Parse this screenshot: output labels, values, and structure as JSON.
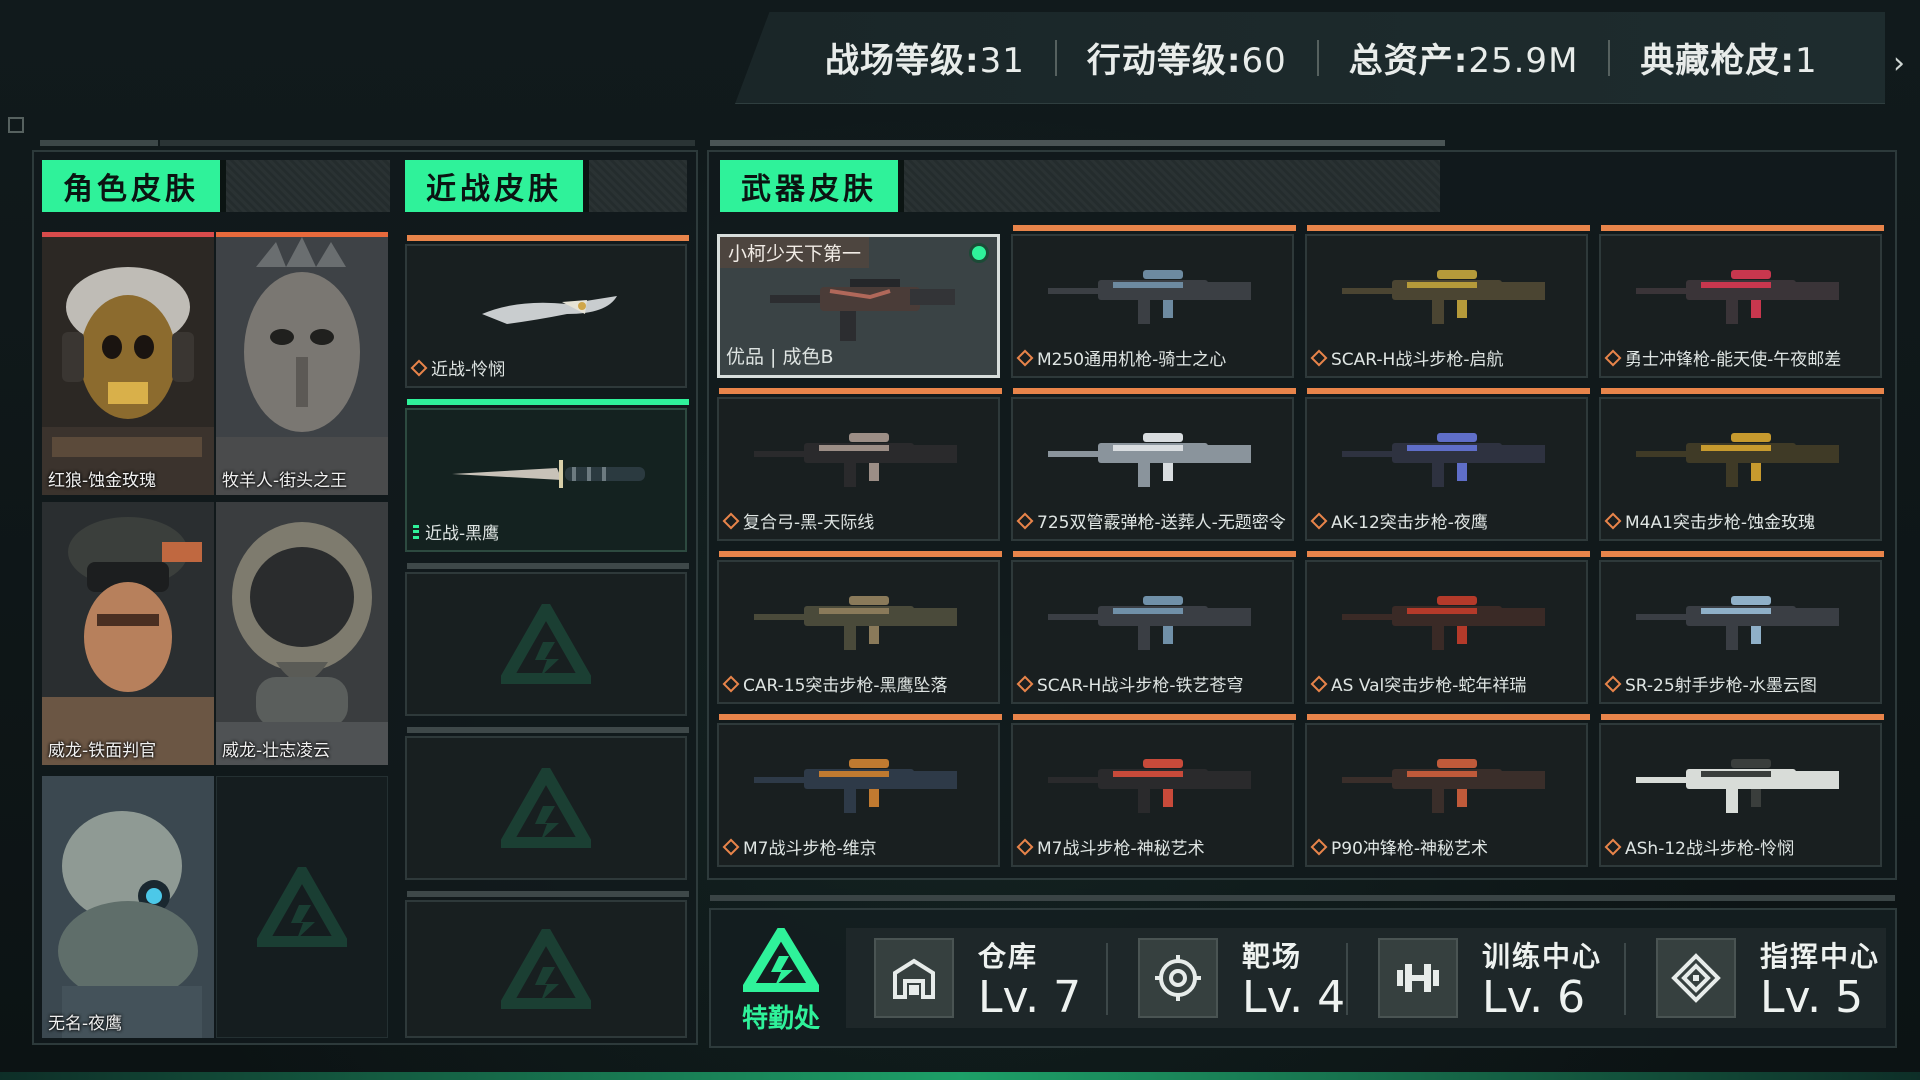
{
  "stats": [
    {
      "label": "战场等级:",
      "value": "31"
    },
    {
      "label": "行动等级:",
      "value": "60"
    },
    {
      "label": "总资产:",
      "value": "25.9M"
    },
    {
      "label": "典藏枪皮:",
      "value": "1"
    }
  ],
  "tabs": {
    "character": "角色皮肤",
    "melee": "近战皮肤",
    "weapon": "武器皮肤"
  },
  "characters": [
    {
      "name": "红狼-蚀金玫瑰"
    },
    {
      "name": "牧羊人-街头之王"
    },
    {
      "name": "威龙-铁面判官"
    },
    {
      "name": "威龙-壮志凌云"
    },
    {
      "name": "无名-夜鹰"
    }
  ],
  "melee": [
    {
      "name": "近战-怜悯"
    },
    {
      "name": "近战-黑鹰"
    }
  ],
  "featured_weapon": {
    "title": "小柯少天下第一",
    "quality": "优品 | 成色B"
  },
  "weapons": [
    "M250通用机枪-骑士之心",
    "SCAR-H战斗步枪-启航",
    "勇士冲锋枪-能天使-午夜邮差",
    "复合弓-黑-天际线",
    "725双管霰弹枪-送葬人-无题密令",
    "AK-12突击步枪-夜鹰",
    "M4A1突击步枪-蚀金玫瑰",
    "CAR-15突击步枪-黑鹰坠落",
    "SCAR-H战斗步枪-铁艺苍穹",
    "AS Val突击步枪-蛇年祥瑞",
    "SR-25射手步枪-水墨云图",
    "M7战斗步枪-维京",
    "M7战斗步枪-神秘艺术",
    "P90冲锋枪-神秘艺术",
    "ASh-12战斗步枪-怜悯"
  ],
  "special_ops": {
    "label": "特勤处"
  },
  "facilities": [
    {
      "name": "仓库",
      "level": "Lv. 7",
      "icon": "warehouse-icon"
    },
    {
      "name": "靶场",
      "level": "Lv. 4",
      "icon": "target-icon"
    },
    {
      "name": "训练中心",
      "level": "Lv. 6",
      "icon": "dumbbell-icon"
    },
    {
      "name": "指挥中心",
      "level": "Lv. 5",
      "icon": "command-icon"
    }
  ],
  "colors": {
    "accent_green": "#2ff29a",
    "rarity_orange": "#e8844a",
    "rarity_red": "#d94b4b"
  }
}
